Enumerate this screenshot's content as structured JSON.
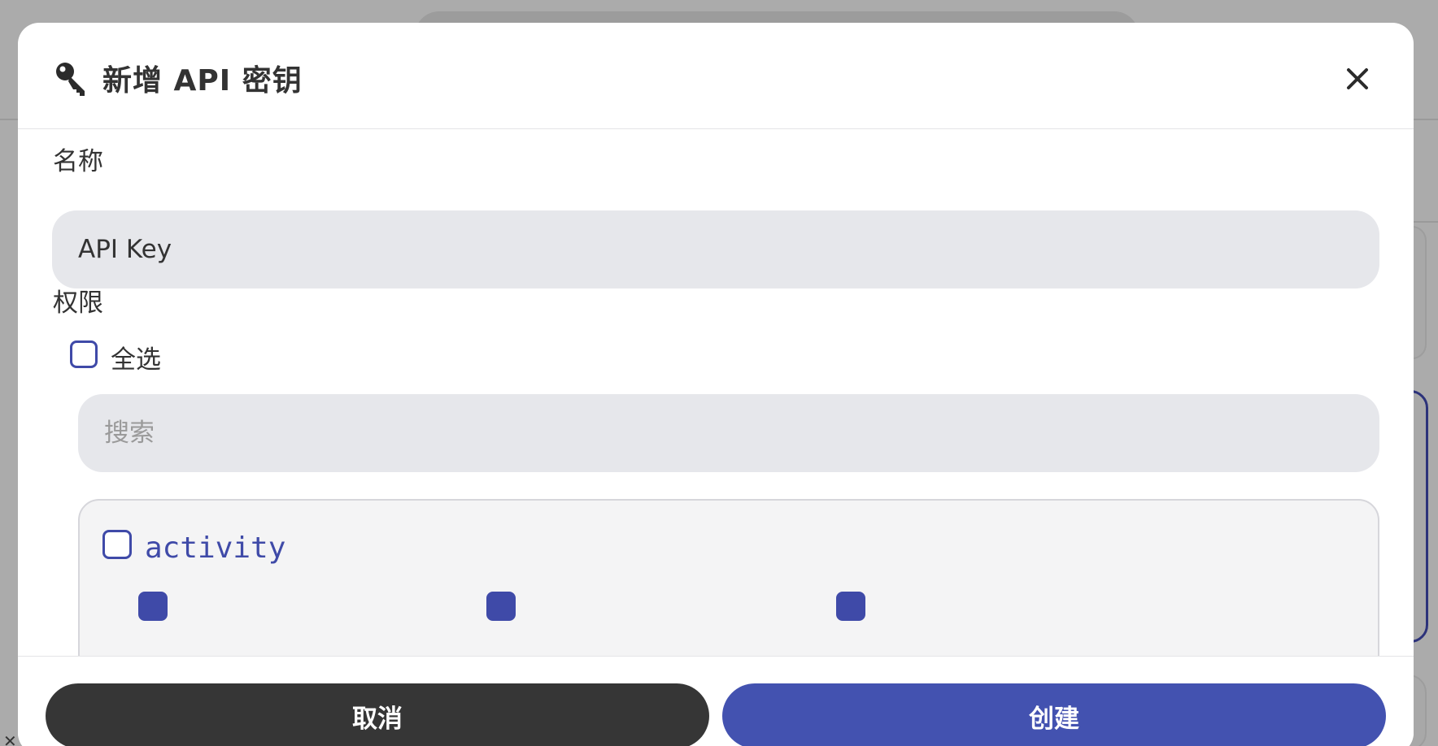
{
  "dialog": {
    "title": "新增 API 密钥",
    "icon": "key-icon",
    "close_icon": "close-icon"
  },
  "form": {
    "name_label": "名称",
    "name_value": "API Key",
    "permissions_label": "权限",
    "select_all_label": "全选",
    "select_all_checked": false,
    "search_placeholder": "搜索",
    "permission_groups": [
      {
        "name": "activity",
        "checked": false
      }
    ]
  },
  "footer": {
    "cancel_label": "取消",
    "create_label": "创建"
  },
  "colors": {
    "accent": "#4352b0",
    "cancel": "#363636",
    "input_bg": "#e6e7eb",
    "overlay": "#ababab"
  }
}
